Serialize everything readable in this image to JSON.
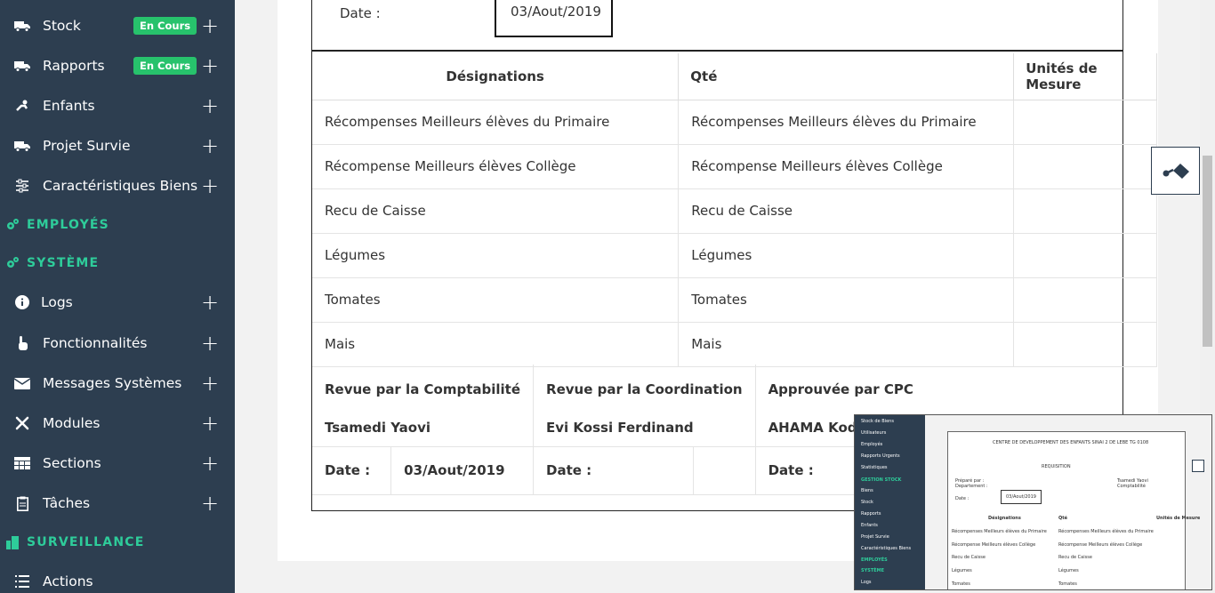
{
  "sidebar": {
    "items": [
      {
        "label": "Stock",
        "icon": "truck-icon",
        "badge": "En Cours"
      },
      {
        "label": "Rapports",
        "icon": "truck-icon",
        "badge": "En Cours"
      },
      {
        "label": "Enfants",
        "icon": "child-icon"
      },
      {
        "label": "Projet Survie",
        "icon": "truck-icon"
      },
      {
        "label": "Caractéristiques Biens",
        "icon": "sliders-icon"
      }
    ],
    "sections": {
      "employes": "EMPLOYÉS",
      "systeme": "SYSTÈME",
      "surveillance": "SURVEILLANCE"
    },
    "system_items": [
      {
        "label": "Logs",
        "icon": "info-icon"
      },
      {
        "label": "Fonctionnalités",
        "icon": "hand-pointer-icon"
      },
      {
        "label": "Messages Systèmes",
        "icon": "envelope-icon"
      },
      {
        "label": "Modules",
        "icon": "tools-icon"
      },
      {
        "label": "Sections",
        "icon": "table-icon"
      },
      {
        "label": "Tâches",
        "icon": "clipboard-icon"
      }
    ],
    "surveillance_items": [
      {
        "label": "Actions",
        "icon": "list-icon"
      }
    ],
    "plus": "+"
  },
  "document": {
    "date_label": "Date :",
    "date_value": "03/Aout/2019",
    "columns": [
      "Désignations",
      "Qté",
      "Unités de Mesure"
    ],
    "rows": [
      [
        "Récompenses Meilleurs élèves du Primaire",
        "Récompenses Meilleurs élèves du Primaire",
        ""
      ],
      [
        "Récompense Meilleurs élèves Collège",
        "Récompense Meilleurs élèves Collège",
        ""
      ],
      [
        "Recu de Caisse",
        "Recu de Caisse",
        ""
      ],
      [
        "Légumes",
        "Légumes",
        ""
      ],
      [
        "Tomates",
        "Tomates",
        ""
      ],
      [
        "Mais",
        "Mais",
        ""
      ]
    ],
    "signatures": {
      "comptabilite_title": "Revue par la Comptabilité",
      "coordination_title": "Revue par la Coordination",
      "cpc_title": "Approuvée par CPC",
      "comptabilite_name": "Tsamedi Yaovi",
      "coordination_name": "Evi Kossi Ferdinand",
      "cpc_name": "AHAMA Kodjo",
      "date_label": "Date :",
      "comptabilite_date": "03/Aout/2019",
      "coordination_date": "",
      "cpc_date": ""
    }
  },
  "preview": {
    "sidebar_items": [
      "Stock de Biens",
      "Utilisateurs",
      "Employés",
      "Rapports Urgents",
      "Statistiques",
      "GESTION STOCK",
      "Biens",
      "Stock",
      "Rapports",
      "Enfants",
      "Projet Survie",
      "Caractéristiques Biens",
      "EMPLOYÉS",
      "SYSTÈME",
      "Logs"
    ],
    "header": "CENTRE DE DEVELOPPEMENT DES ENFANTS SINAI 2 DE LEBE TG 0108",
    "title": "REQUISITION",
    "prepared": "Préparé par :",
    "department": "Departement :",
    "name": "Tsamedi Yaovi",
    "role": "Comptabilité",
    "date_label": "Date :",
    "date": "03/Aout/2019",
    "columns": [
      "Désignations",
      "Qté",
      "Unités de Mesure"
    ],
    "rows": [
      [
        "Récompenses Meilleurs élèves du Primaire",
        "Récompenses Meilleurs élèves du Primaire"
      ],
      [
        "Récompense Meilleurs élèves Collège",
        "Récompense Meilleurs élèves Collège"
      ],
      [
        "Recu de Caisse",
        "Recu de Caisse"
      ],
      [
        "Légumes",
        "Légumes"
      ],
      [
        "Tomates",
        "Tomates"
      ]
    ]
  }
}
